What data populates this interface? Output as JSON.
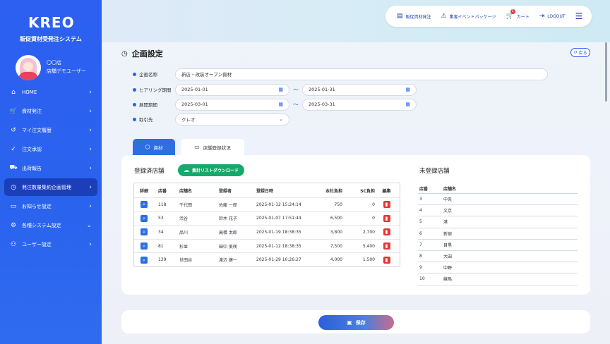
{
  "brand": {
    "logo_main": "KRE",
    "logo_tail": "O",
    "subtitle": "販促資材受発注システム"
  },
  "user": {
    "store": "〇〇店",
    "name": "店舗デモユーザー"
  },
  "sidebar": {
    "items": [
      {
        "label": "HOME",
        "icon": "home-icon",
        "glyph": "⌂",
        "chevron": "›"
      },
      {
        "label": "資材発注",
        "icon": "cart-icon",
        "glyph": "🛒",
        "chevron": "›"
      },
      {
        "label": "マイ注文履歴",
        "icon": "history-icon",
        "glyph": "↺",
        "chevron": "›"
      },
      {
        "label": "注文承認",
        "icon": "check-circle-icon",
        "glyph": "✓",
        "chevron": "›"
      },
      {
        "label": "出荷報告",
        "icon": "truck-icon",
        "glyph": "⛟",
        "chevron": "›"
      },
      {
        "label": "発注数量集約企画管理",
        "icon": "clock-icon",
        "glyph": "◷",
        "chevron": "›",
        "active": true
      },
      {
        "label": "お知らせ設定",
        "icon": "message-icon",
        "glyph": "▭",
        "chevron": "›"
      },
      {
        "label": "各種システム設定",
        "icon": "gear-icon",
        "glyph": "⚙",
        "chevron": "⌄"
      },
      {
        "label": "ユーザー設定",
        "icon": "users-icon",
        "glyph": "⚇",
        "chevron": "›"
      }
    ]
  },
  "topbar": {
    "order_label": "販促資材発注",
    "package_label": "集客イベントパッケージ",
    "cart_label": "カート",
    "cart_count": "1",
    "logout_label": "LOGOUT"
  },
  "page": {
    "title": "企画設定",
    "back_label": "戻る"
  },
  "form": {
    "plan_name_label": "企画名称",
    "plan_name_value": "新店・改装オープン資材",
    "hearing_label": "ヒアリング期間",
    "hearing_from": "2025-01-01",
    "hearing_to": "2025-01-31",
    "deploy_label": "展開期間",
    "deploy_from": "2025-03-01",
    "deploy_to": "2025-03-31",
    "partner_label": "取引先",
    "partner_value": "クレオ",
    "tilde": "〜"
  },
  "tabs": {
    "materials": "資材",
    "store_status": "店舗登録状況"
  },
  "registered": {
    "title": "登録済店舗",
    "download_label": "集計リストダウンロード",
    "headers": [
      "詳細",
      "店番",
      "店舗名",
      "登録者",
      "登録日時",
      "本社負担",
      "SC負担",
      "編集"
    ],
    "rows": [
      {
        "store_no": "118",
        "store_name": "千代田",
        "registrant": "佐藤 一郎",
        "datetime": "2025-01-12 15:24:14",
        "hq": "750",
        "sc": "0"
      },
      {
        "store_no": "53",
        "store_name": "渋谷",
        "registrant": "鈴木 花子",
        "datetime": "2025-01-07 17:51:44",
        "hq": "6,500",
        "sc": "0"
      },
      {
        "store_no": "34",
        "store_name": "品川",
        "registrant": "高橋 太郎",
        "datetime": "2025-01-19 18:38:35",
        "hq": "3,800",
        "sc": "2,700"
      },
      {
        "store_no": "81",
        "store_name": "杉並",
        "registrant": "田中 美咲",
        "datetime": "2025-01-12 18:38:35",
        "hq": "7,500",
        "sc": "5,400"
      },
      {
        "store_no": "129",
        "store_name": "世田谷",
        "registrant": "渡辺 健一",
        "datetime": "2025-01-29 10:26:27",
        "hq": "4,000",
        "sc": "1,500"
      }
    ]
  },
  "unregistered": {
    "title": "未登録店舗",
    "headers": [
      "店番",
      "店舗名"
    ],
    "rows": [
      {
        "no": "3",
        "name": "中央"
      },
      {
        "no": "4",
        "name": "文京"
      },
      {
        "no": "5",
        "name": "港"
      },
      {
        "no": "6",
        "name": "新宿"
      },
      {
        "no": "7",
        "name": "目黒"
      },
      {
        "no": "8",
        "name": "大田"
      },
      {
        "no": "9",
        "name": "中野"
      },
      {
        "no": "10",
        "name": "練馬"
      }
    ]
  },
  "footer": {
    "save_label": "保存"
  },
  "colors": {
    "sidebar": "#2d5ff0",
    "accent": "#2d6fe0",
    "download": "#17a86b",
    "delete": "#e53935"
  }
}
